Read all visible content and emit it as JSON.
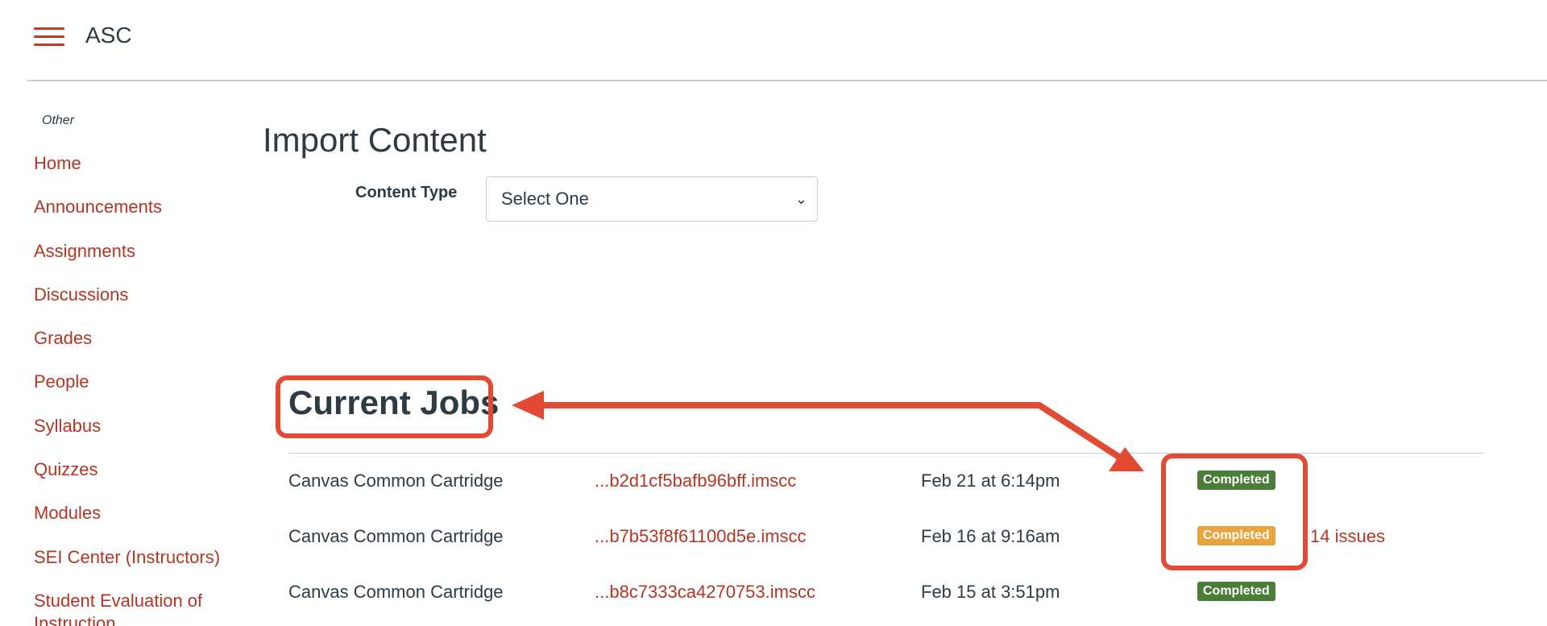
{
  "header": {
    "course_title": "ASC"
  },
  "sidebar": {
    "section_label": "Other",
    "items": [
      {
        "label": "Home"
      },
      {
        "label": "Announcements"
      },
      {
        "label": "Assignments"
      },
      {
        "label": "Discussions"
      },
      {
        "label": "Grades"
      },
      {
        "label": "People"
      },
      {
        "label": "Syllabus"
      },
      {
        "label": "Quizzes"
      },
      {
        "label": "Modules"
      },
      {
        "label": "SEI Center (Instructors)"
      },
      {
        "label": "Student Evaluation of Instruction"
      }
    ]
  },
  "main": {
    "page_title": "Import Content",
    "content_type_label": "Content Type",
    "content_type_value": "Select One",
    "jobs_title": "Current Jobs",
    "jobs": [
      {
        "type": "Canvas Common Cartridge",
        "file": "...b2d1cf5bafb96bff.imscc",
        "date": "Feb 21 at 6:14pm",
        "status": "Completed",
        "issues": ""
      },
      {
        "type": "Canvas Common Cartridge",
        "file": "...b7b53f8f61100d5e.imscc",
        "date": "Feb 16 at 9:16am",
        "status": "Completed",
        "issues": "14 issues"
      },
      {
        "type": "Canvas Common Cartridge",
        "file": "...b8c7333ca4270753.imscc",
        "date": "Feb 15 at 3:51pm",
        "status": "Completed",
        "issues": ""
      }
    ]
  },
  "colors": {
    "link": "#b53524",
    "status_success": "#4a7c3a",
    "status_warning": "#e8a43d",
    "annotation": "#e34a33"
  },
  "icons": {
    "menu": "hamburger-icon",
    "select": "chevron-down-icon"
  }
}
